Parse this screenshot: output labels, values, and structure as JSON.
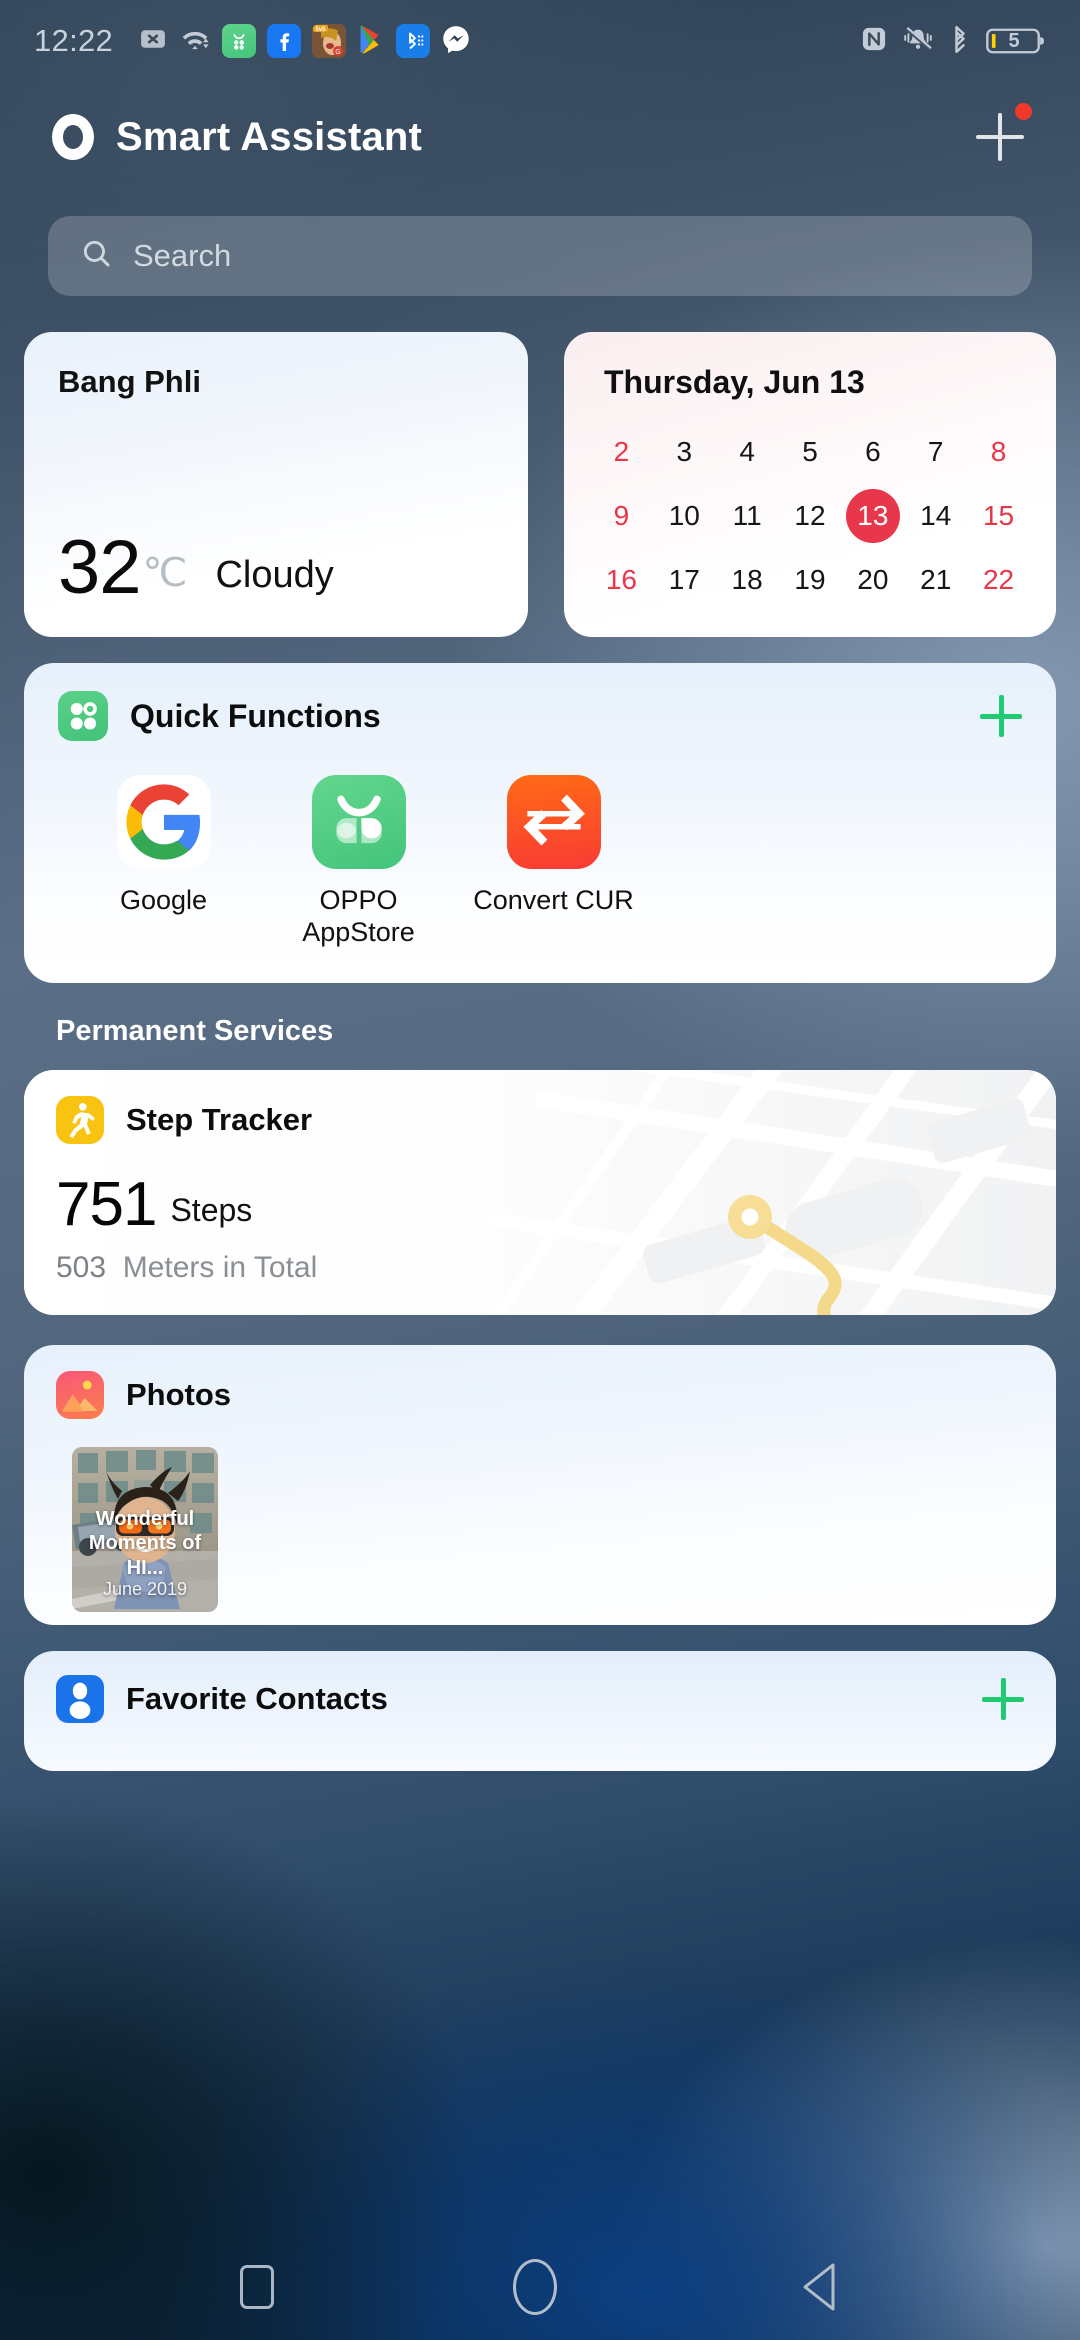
{
  "statusbar": {
    "time": "12:22",
    "left_icons": [
      {
        "name": "sim-no-signal-icon",
        "label": "SIM"
      },
      {
        "name": "wifi-icon",
        "label": "WiFi"
      },
      {
        "name": "oppo-appstore-icon",
        "label": "OPPO AppStore"
      },
      {
        "name": "facebook-icon",
        "label": "Facebook"
      },
      {
        "name": "mobile-legends-icon",
        "label": "Mobile Legends"
      },
      {
        "name": "google-play-icon",
        "label": "Google Play"
      },
      {
        "name": "bluetooth-share-icon",
        "label": "Bluetooth Share"
      },
      {
        "name": "messenger-icon",
        "label": "Messenger"
      }
    ],
    "right_icons": [
      {
        "name": "nfc-icon",
        "label": "NFC"
      },
      {
        "name": "vibrate-mute-icon",
        "label": "Silent"
      },
      {
        "name": "bluetooth-icon",
        "label": "Bluetooth"
      }
    ],
    "battery_level": "5"
  },
  "header": {
    "title": "Smart Assistant",
    "logo": "oppo-ring-logo",
    "add_button": "add-card-button",
    "has_notification_dot": true
  },
  "search": {
    "placeholder": "Search",
    "icon": "search-icon"
  },
  "weather": {
    "city": "Bang Phli",
    "temperature": "32",
    "unit": "℃",
    "condition": "Cloudy"
  },
  "calendar": {
    "title": "Thursday, Jun 13",
    "today": 13,
    "weekend_days": [
      2,
      8,
      9,
      15,
      16,
      22
    ],
    "days": [
      2,
      3,
      4,
      5,
      6,
      7,
      8,
      9,
      10,
      11,
      12,
      13,
      14,
      15,
      16,
      17,
      18,
      19,
      20,
      21,
      22
    ]
  },
  "quick_functions": {
    "title": "Quick Functions",
    "icon": "quick-functions-icon",
    "add_label": "+",
    "apps": [
      {
        "name": "google-icon",
        "label": "Google"
      },
      {
        "name": "oppo-appstore-icon",
        "label": "OPPO AppStore"
      },
      {
        "name": "convert-cur-icon",
        "label": "Convert CUR"
      }
    ]
  },
  "permanent_services": {
    "label": "Permanent Services"
  },
  "step_tracker": {
    "title": "Step Tracker",
    "icon": "step-tracker-icon",
    "steps_value": "751",
    "steps_unit": "Steps",
    "distance_value": "503",
    "distance_unit": "Meters in Total"
  },
  "photos": {
    "title": "Photos",
    "icon": "photos-icon",
    "memory": {
      "title": "Wonderful Moments of HI...",
      "date": "June 2019"
    }
  },
  "favorite_contacts": {
    "title": "Favorite Contacts",
    "icon": "contacts-icon",
    "add_label": "+"
  },
  "navbar": {
    "recents": "recents-button",
    "home": "home-button",
    "back": "back-button"
  },
  "colors": {
    "accent_green": "#1ecb72",
    "accent_red": "#e8364a",
    "notification_red": "#f0392b",
    "step_yellow": "#f9c312"
  }
}
